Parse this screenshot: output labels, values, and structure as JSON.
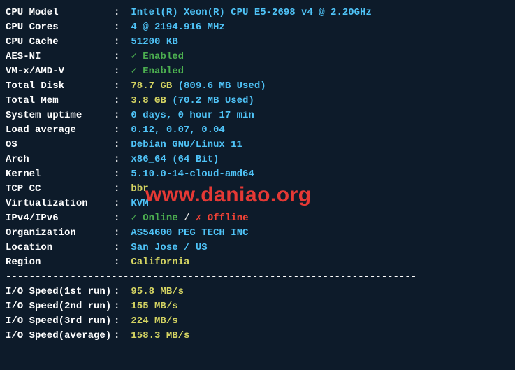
{
  "rows": [
    {
      "label": "CPU Model",
      "parts": [
        {
          "text": "Intel(R) Xeon(R) CPU E5-2698 v4 @ 2.20GHz",
          "cls": "cyan bold"
        }
      ]
    },
    {
      "label": "CPU Cores",
      "parts": [
        {
          "text": "4 @ 2194.916 MHz",
          "cls": "cyan bold"
        }
      ]
    },
    {
      "label": "CPU Cache",
      "parts": [
        {
          "text": "51200 KB",
          "cls": "cyan bold"
        }
      ]
    },
    {
      "label": "AES-NI",
      "parts": [
        {
          "text": "✓ ",
          "cls": "check bold"
        },
        {
          "text": "Enabled",
          "cls": "green bold"
        }
      ]
    },
    {
      "label": "VM-x/AMD-V",
      "parts": [
        {
          "text": "✓ ",
          "cls": "check bold"
        },
        {
          "text": "Enabled",
          "cls": "green bold"
        }
      ]
    },
    {
      "label": "Total Disk",
      "parts": [
        {
          "text": "78.7 GB",
          "cls": "yellow bold"
        },
        {
          "text": " (809.6 MB Used)",
          "cls": "cyan bold"
        }
      ]
    },
    {
      "label": "Total Mem",
      "parts": [
        {
          "text": "3.8 GB",
          "cls": "yellow bold"
        },
        {
          "text": " (70.2 MB Used)",
          "cls": "cyan bold"
        }
      ]
    },
    {
      "label": "System uptime",
      "parts": [
        {
          "text": "0 days, 0 hour 17 min",
          "cls": "cyan bold"
        }
      ]
    },
    {
      "label": "Load average",
      "parts": [
        {
          "text": "0.12, 0.07, 0.04",
          "cls": "cyan bold"
        }
      ]
    },
    {
      "label": "OS",
      "parts": [
        {
          "text": "Debian GNU/Linux 11",
          "cls": "cyan bold"
        }
      ]
    },
    {
      "label": "Arch",
      "parts": [
        {
          "text": "x86_64 (64 Bit)",
          "cls": "cyan bold"
        }
      ]
    },
    {
      "label": "Kernel",
      "parts": [
        {
          "text": "5.10.0-14-cloud-amd64",
          "cls": "cyan bold"
        }
      ]
    },
    {
      "label": "TCP CC",
      "parts": [
        {
          "text": "bbr",
          "cls": "yellow bold"
        }
      ]
    },
    {
      "label": "Virtualization",
      "parts": [
        {
          "text": "KVM",
          "cls": "cyan bold"
        }
      ]
    },
    {
      "label": "IPv4/IPv6",
      "parts": [
        {
          "text": "✓ ",
          "cls": "check bold"
        },
        {
          "text": "Online",
          "cls": "green bold"
        },
        {
          "text": " / ",
          "cls": "white bold"
        },
        {
          "text": "✗ ",
          "cls": "cross bold"
        },
        {
          "text": "Offline",
          "cls": "red bold"
        }
      ]
    },
    {
      "label": "Organization",
      "parts": [
        {
          "text": "AS54600 PEG TECH INC",
          "cls": "cyan bold"
        }
      ]
    },
    {
      "label": "Location",
      "parts": [
        {
          "text": "San Jose / US",
          "cls": "cyan bold"
        }
      ]
    },
    {
      "label": "Region",
      "parts": [
        {
          "text": "California",
          "cls": "yellow bold"
        }
      ]
    }
  ],
  "io_rows": [
    {
      "label": "I/O Speed(1st run)",
      "parts": [
        {
          "text": "95.8 MB/s",
          "cls": "yellow bold"
        }
      ]
    },
    {
      "label": "I/O Speed(2nd run)",
      "parts": [
        {
          "text": "155 MB/s",
          "cls": "yellow bold"
        }
      ]
    },
    {
      "label": "I/O Speed(3rd run)",
      "parts": [
        {
          "text": "224 MB/s",
          "cls": "yellow bold"
        }
      ]
    },
    {
      "label": "I/O Speed(average)",
      "parts": [
        {
          "text": "158.3 MB/s",
          "cls": "yellow bold"
        }
      ]
    }
  ],
  "divider": "----------------------------------------------------------------------",
  "watermark": "www.daniao.org"
}
